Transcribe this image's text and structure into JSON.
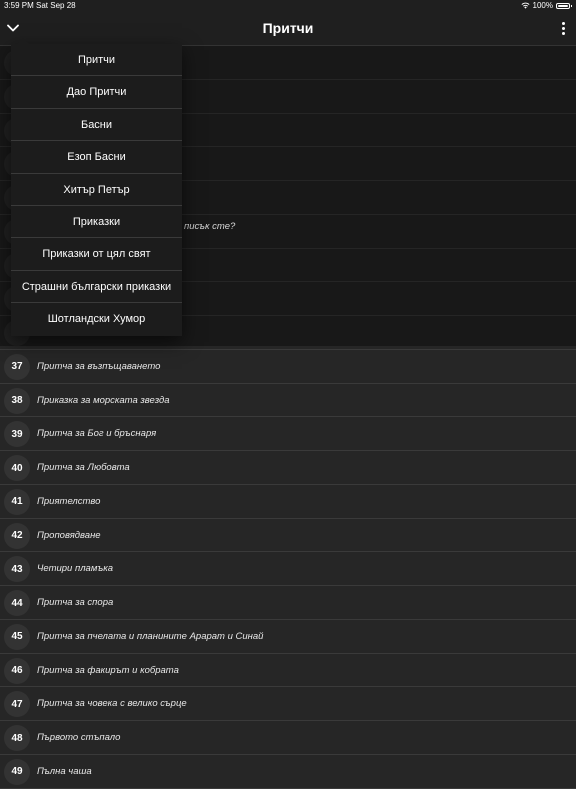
{
  "status_bar": {
    "time": "3:59 PM",
    "date": "Sat Sep 28",
    "battery": "100%"
  },
  "nav": {
    "title": "Притчи"
  },
  "dropdown": {
    "items": [
      "Притчи",
      "Дао Притчи",
      "Басни",
      "Езоп Басни",
      "Хитър Петър",
      "Приказки",
      "Приказки от цял свят",
      "Страшни български приказки",
      "Шотландски Хумор"
    ]
  },
  "peek_text": "писък сте?",
  "list": {
    "hidden_rows": 9,
    "rows": [
      {
        "num": "37",
        "title": "Притча за възпъщаването"
      },
      {
        "num": "38",
        "title": "Приказка за морската звезда"
      },
      {
        "num": "39",
        "title": "Притча за Бог и бръснаря"
      },
      {
        "num": "40",
        "title": "Притча за Любовта"
      },
      {
        "num": "41",
        "title": "Приятелство"
      },
      {
        "num": "42",
        "title": "Проповядване"
      },
      {
        "num": "43",
        "title": "Четири пламъка"
      },
      {
        "num": "44",
        "title": "Притча за спора"
      },
      {
        "num": "45",
        "title": "Притча за пчелата и планините Арарат и Синай"
      },
      {
        "num": "46",
        "title": "Притча за факирът и кобрата"
      },
      {
        "num": "47",
        "title": "Притча за човека с велико сърце"
      },
      {
        "num": "48",
        "title": "Първото стъпало"
      },
      {
        "num": "49",
        "title": "Пълна чаша"
      }
    ]
  }
}
